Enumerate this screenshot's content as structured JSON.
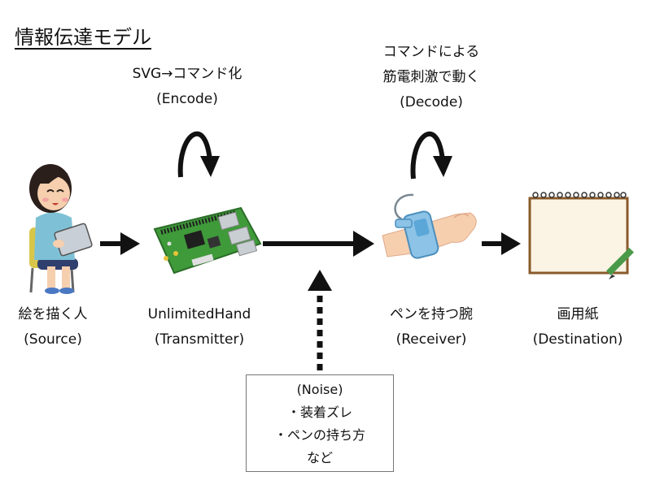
{
  "title": "情報伝達モデル",
  "encode_label": {
    "line1": "SVG→コマンド化",
    "line2": "(Encode)"
  },
  "decode_label": {
    "line1": "コマンドによる",
    "line2": "筋電刺激で動く",
    "line3": "(Decode)"
  },
  "nodes": [
    {
      "name": "絵を描く人",
      "role": "(Source)"
    },
    {
      "name": "UnlimitedHand",
      "role": "(Transmitter)"
    },
    {
      "name": "ペンを持つ腕",
      "role": "(Receiver)"
    },
    {
      "name": "画用紙",
      "role": "(Destination)"
    }
  ],
  "noise": {
    "title": "(Noise)",
    "items": [
      "・装着ズレ",
      "・ペンの持ち方",
      "など"
    ]
  },
  "colors": {
    "arrow": "#111111",
    "board": "#3f9a3a",
    "skin": "#f6cfae",
    "band": "#8cc3e6",
    "paper": "#fbf4e4",
    "shirt": "#7ec1d6"
  }
}
